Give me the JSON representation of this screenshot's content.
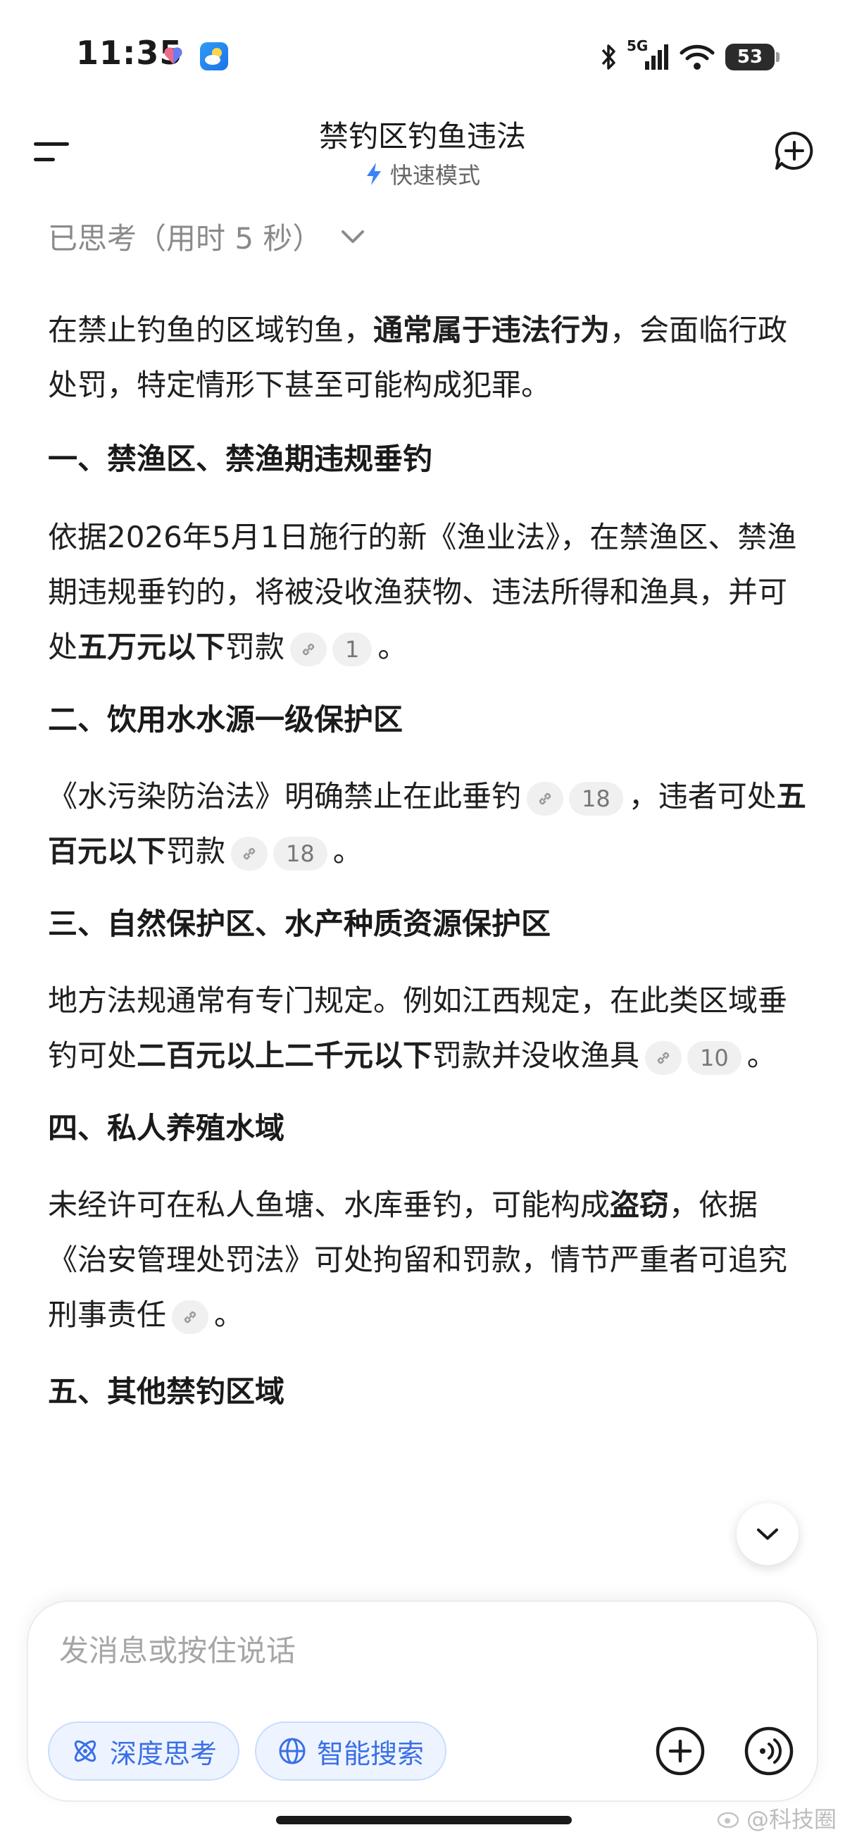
{
  "status_bar": {
    "time": "11:35",
    "network": "5G",
    "battery": "53"
  },
  "header": {
    "title": "禁钓区钓鱼违法",
    "mode": "快速模式"
  },
  "thinking": {
    "label": "已思考（用时 5 秒）"
  },
  "intro": {
    "t1": "在禁止钓鱼的区域钓鱼，",
    "b1": "通常属于违法行为",
    "t2": "，会面临行政处罚，特定情形下甚至可能构成犯罪。"
  },
  "sections": [
    {
      "heading": "一、禁渔区、禁渔期违规垂钓",
      "t1": "依据2026年5月1日施行的新《渔业法》，在禁渔区、禁渔期违规垂钓的，将被没收渔获物、违法所得和渔具，并可处",
      "b1": "五万元以下",
      "t2": "罚款",
      "cite": "1",
      "t3": "。"
    },
    {
      "heading": "二、饮用水水源一级保护区",
      "t1": "《水污染防治法》明确禁止在此垂钓",
      "cite1": "18",
      "t2": "，违者可处",
      "b1": "五百元以下",
      "t3": "罚款",
      "cite2": "18",
      "t4": "。"
    },
    {
      "heading": "三、自然保护区、水产种质资源保护区",
      "t1": "地方法规通常有专门规定。例如江西规定，在此类区域垂钓可处",
      "b1": "二百元以上二千元以下",
      "t2": "罚款并没收渔具",
      "cite": "10",
      "t3": "。"
    },
    {
      "heading": "四、私人养殖水域",
      "t1": "未经许可在私人鱼塘、水库垂钓，可能构成",
      "b1": "盗窃",
      "t2": "，依据《治安管理处罚法》可处拘留和罚款，情节严重者可追究刑事责任",
      "t3": "。"
    },
    {
      "heading": "五、其他禁钓区域"
    }
  ],
  "input": {
    "placeholder": "发消息或按住说话",
    "deep_think": "深度思考",
    "smart_search": "智能搜索"
  },
  "watermark": "@科技圈",
  "colors": {
    "accent": "#3b6fe6",
    "chip_bg": "#eef4ff"
  }
}
